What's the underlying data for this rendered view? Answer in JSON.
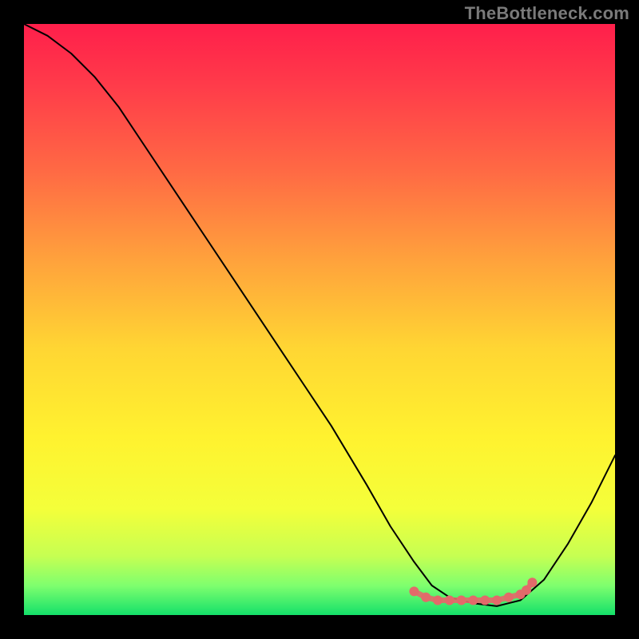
{
  "watermark": "TheBottleneck.com",
  "chart_data": {
    "type": "line",
    "title": "",
    "xlabel": "",
    "ylabel": "",
    "xlim": [
      0,
      100
    ],
    "ylim": [
      0,
      100
    ],
    "background_gradient": {
      "stops": [
        {
          "offset": 0.0,
          "color": "#ff1f4b"
        },
        {
          "offset": 0.1,
          "color": "#ff3a4a"
        },
        {
          "offset": 0.25,
          "color": "#ff6a44"
        },
        {
          "offset": 0.4,
          "color": "#ffa23c"
        },
        {
          "offset": 0.55,
          "color": "#ffd633"
        },
        {
          "offset": 0.7,
          "color": "#fff22f"
        },
        {
          "offset": 0.82,
          "color": "#f4ff3a"
        },
        {
          "offset": 0.9,
          "color": "#c6ff52"
        },
        {
          "offset": 0.95,
          "color": "#7fff6e"
        },
        {
          "offset": 1.0,
          "color": "#14e06a"
        }
      ]
    },
    "series": [
      {
        "name": "bottleneck-curve",
        "color": "#000000",
        "width": 2,
        "x": [
          0,
          4,
          8,
          12,
          16,
          20,
          28,
          36,
          44,
          52,
          58,
          62,
          66,
          69,
          72,
          76,
          80,
          84,
          88,
          92,
          96,
          100
        ],
        "values": [
          100,
          98,
          95,
          91,
          86,
          80,
          68,
          56,
          44,
          32,
          22,
          15,
          9,
          5,
          3,
          2,
          1.5,
          2.5,
          6,
          12,
          19,
          27
        ]
      }
    ],
    "highlight_band": {
      "name": "optimal-range",
      "color": "#e26a6a",
      "x": [
        66,
        68,
        70,
        72,
        74,
        76,
        78,
        80,
        82,
        84,
        85,
        86
      ],
      "values": [
        4,
        3,
        2.5,
        2.5,
        2.5,
        2.5,
        2.5,
        2.5,
        3,
        3.5,
        4.2,
        5.5
      ],
      "marker_radius": 6
    }
  }
}
